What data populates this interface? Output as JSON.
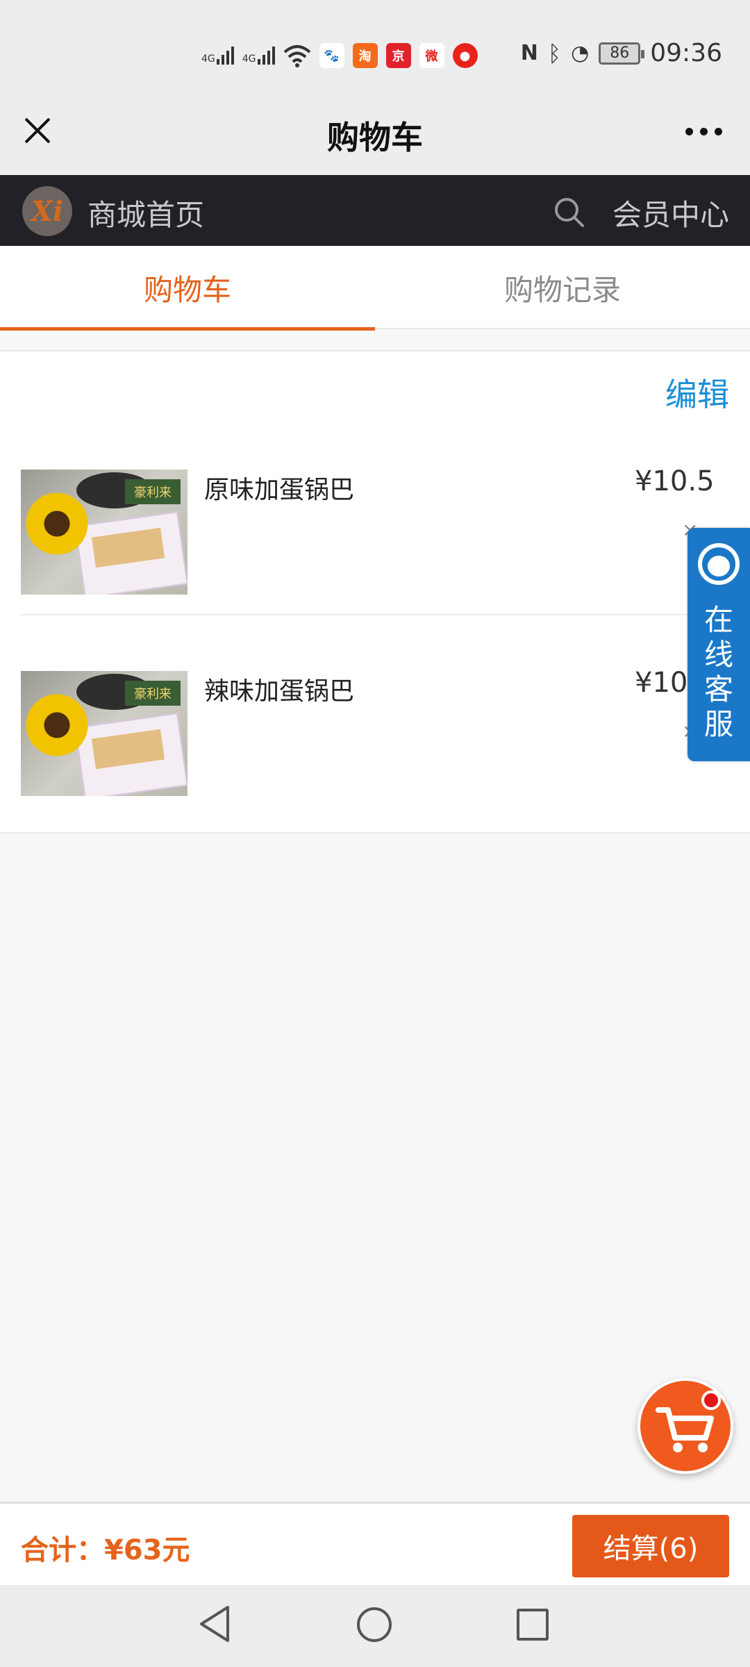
{
  "statusbar": {
    "net1": "4G",
    "net2": "4G",
    "time": "09:36",
    "battery": "86",
    "apps": [
      {
        "icon": "baidu-icon",
        "glyph": "🐾",
        "color": "#2f6fe0"
      },
      {
        "icon": "taobao-icon",
        "glyph": "淘",
        "color": "#f36b1c"
      },
      {
        "icon": "jd-icon",
        "glyph": "京",
        "color": "#e0232a"
      },
      {
        "icon": "weibo-icon",
        "glyph": "微",
        "color": "#f8c02a"
      },
      {
        "icon": "app-red-icon",
        "glyph": "●",
        "color": "#e8231b"
      }
    ]
  },
  "header": {
    "title": "购物车",
    "close_icon": "close-icon",
    "more_icon": "more-icon"
  },
  "shopnav": {
    "logo": "Xi",
    "home_label": "商城首页",
    "member_label": "会员中心"
  },
  "tabs": [
    {
      "label": "购物车",
      "active": true
    },
    {
      "label": "购物记录",
      "active": false
    }
  ],
  "cart": {
    "edit_label": "编辑",
    "items": [
      {
        "name": "原味加蛋锅巴",
        "price": "¥10.5"
      },
      {
        "name": "辣味加蛋锅巴",
        "price": "¥10.5"
      }
    ]
  },
  "service": {
    "label": "在线客服"
  },
  "footer": {
    "total": "合计：¥63元",
    "checkout": "结算(6)"
  },
  "colors": {
    "accent": "#e4631b",
    "link": "#1a8fd8",
    "dark_nav": "#222127",
    "service": "#1b78c8"
  }
}
